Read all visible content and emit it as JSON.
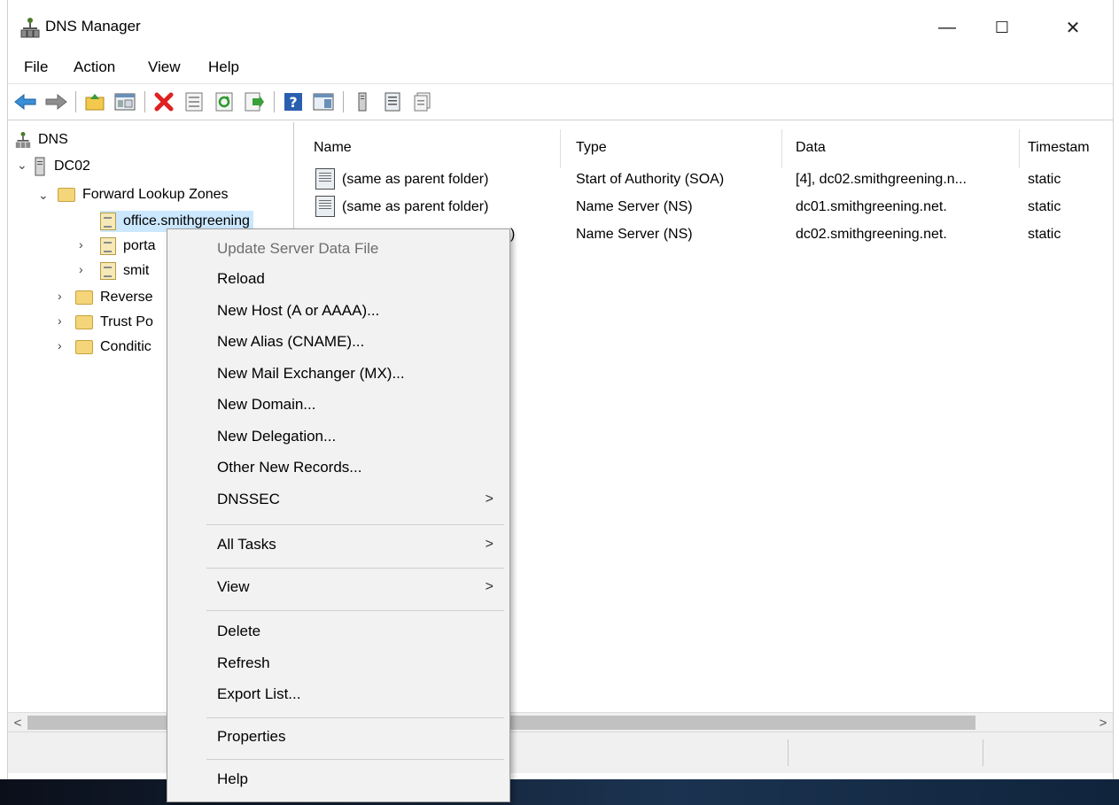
{
  "window": {
    "title": "DNS Manager",
    "minimize": "—",
    "maximize": "☐",
    "close": "✕"
  },
  "menubar": [
    "File",
    "Action",
    "View",
    "Help"
  ],
  "toolbar": [
    "back-icon",
    "forward-icon",
    "up-folder-icon",
    "show-hide-tree-icon",
    "delete-icon",
    "properties-icon",
    "refresh-icon",
    "export-icon",
    "help-icon",
    "action-pane-icon",
    "server-icon",
    "list-icon",
    "records-icon"
  ],
  "tree": {
    "root": "DNS",
    "server": "DC02",
    "forward": "Forward Lookup Zones",
    "zones": [
      "office.smithgreening",
      "porta",
      "smit"
    ],
    "others": [
      "Reverse",
      "Trust Po",
      "Conditic"
    ]
  },
  "list": {
    "columns": [
      "Name",
      "Type",
      "Data",
      "Timestam"
    ],
    "rows": [
      {
        "name": "(same as parent folder)",
        "type": "Start of Authority (SOA)",
        "data": "[4], dc02.smithgreening.n...",
        "ts": "static"
      },
      {
        "name": "(same as parent folder)",
        "type": "Name Server (NS)",
        "data": "dc01.smithgreening.net.",
        "ts": "static"
      },
      {
        "name": ")",
        "type": "Name Server (NS)",
        "data": "dc02.smithgreening.net.",
        "ts": "static"
      }
    ]
  },
  "scroll": {
    "left": "<",
    "right": ">"
  },
  "context_menu": {
    "items": [
      {
        "label": "Update Server Data File",
        "disabled": true
      },
      {
        "label": "Reload"
      },
      {
        "label": "New Host (A or AAAA)..."
      },
      {
        "label": "New Alias (CNAME)..."
      },
      {
        "label": "New Mail Exchanger (MX)..."
      },
      {
        "label": "New Domain..."
      },
      {
        "label": "New Delegation..."
      },
      {
        "label": "Other New Records..."
      },
      {
        "label": "DNSSEC",
        "submenu": ">"
      },
      {
        "label": "All Tasks",
        "submenu": ">"
      },
      {
        "label": "View",
        "submenu": ">"
      },
      {
        "label": "Delete"
      },
      {
        "label": "Refresh"
      },
      {
        "label": "Export List..."
      },
      {
        "label": "Properties"
      },
      {
        "label": "Help"
      }
    ]
  }
}
